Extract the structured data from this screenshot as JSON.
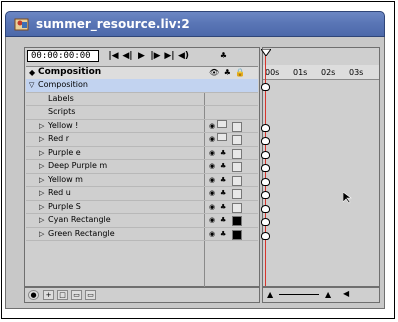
{
  "window": {
    "title": "summer_resource.liv:2"
  },
  "toolbar": {
    "timecode": "00:00:00:00",
    "buttons": [
      "|◀◀",
      "◀|",
      "▶",
      "|▶",
      "▶▶|",
      "◀)"
    ]
  },
  "header": {
    "label": "Composition",
    "col_icons": "👁 ♣ 🔒"
  },
  "layers": [
    {
      "label": "Composition",
      "selected": true,
      "expand": "▽"
    },
    {
      "label": "Labels",
      "selected": false
    },
    {
      "label": "Scripts",
      "selected": false
    },
    {
      "label": "Yellow !",
      "selected": false,
      "expand": "▷"
    },
    {
      "label": "Red r",
      "selected": false,
      "expand": "▷"
    },
    {
      "label": "Purple e",
      "selected": false,
      "expand": "▷"
    },
    {
      "label": "Deep Purple m",
      "selected": false,
      "expand": "▷"
    },
    {
      "label": "Yellow m",
      "selected": false,
      "expand": "▷"
    },
    {
      "label": "Red u",
      "selected": false,
      "expand": "▷"
    },
    {
      "label": "Purple S",
      "selected": false,
      "expand": "▷"
    },
    {
      "label": "Cyan Rectangle",
      "selected": false,
      "expand": "▷"
    },
    {
      "label": "Green Rectangle",
      "selected": false,
      "expand": "▷"
    }
  ],
  "timeline": {
    "ticks": [
      "00s",
      "01s",
      "02s",
      "03s"
    ]
  },
  "colors": {
    "titlebar": "#5a76b6",
    "selection": "#c2d3f0",
    "playhead": "#d8342c"
  }
}
